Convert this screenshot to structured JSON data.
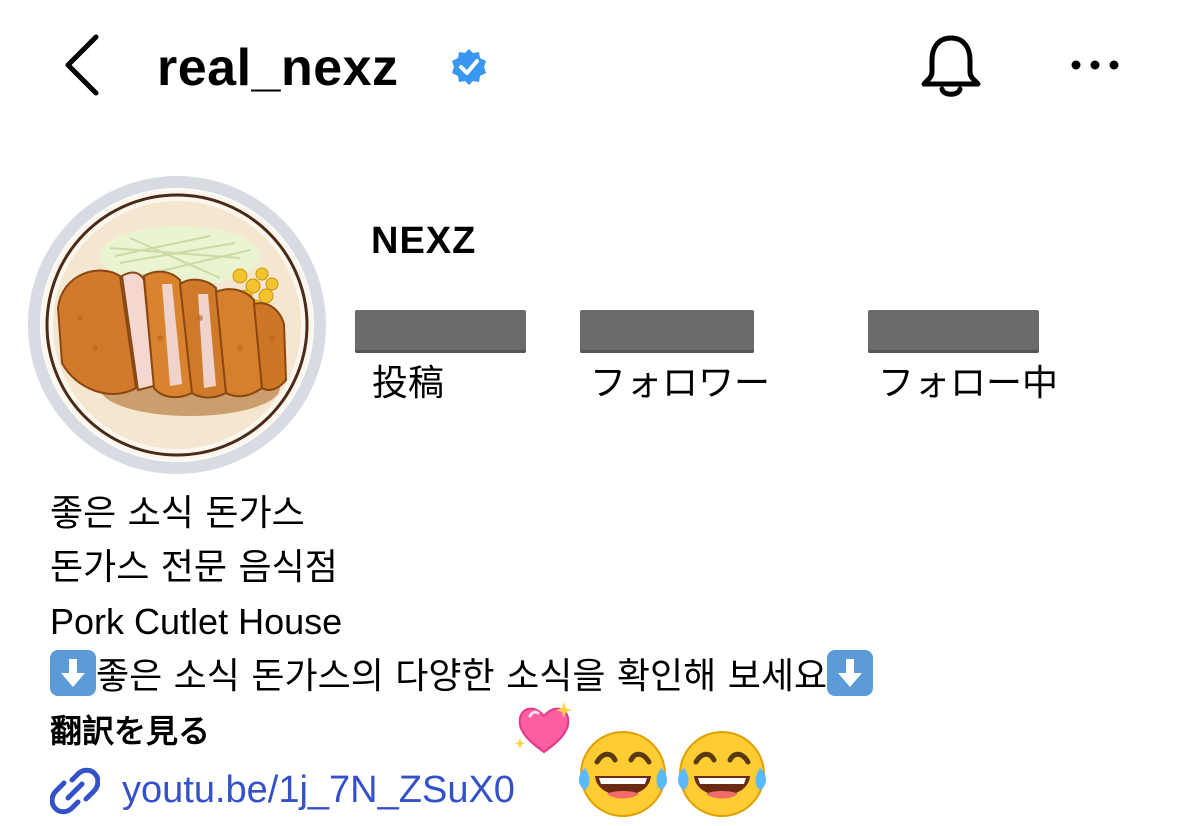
{
  "header": {
    "username": "real_nexz",
    "icons": [
      "back-chevron-icon",
      "verified-badge-icon",
      "bell-icon",
      "more-icon"
    ]
  },
  "profile": {
    "display_name": "NEXZ",
    "avatar_icon": "pork-cutlet-plate-image",
    "stats": [
      {
        "label": "投稿"
      },
      {
        "label": "フォロワー"
      },
      {
        "label": "フォロー中"
      }
    ]
  },
  "bio": {
    "line1": "좋은 소식 돈가스",
    "line2": "돈가스 전문 음식점",
    "line3": "Pork Cutlet House",
    "line4": "좋은 소식 돈가스의 다양한 소식을 확인해 보세요",
    "line4_icons": [
      "down-arrow-icon",
      "down-arrow-icon"
    ],
    "see_translation": "翻訳を見る",
    "link": "youtu.be/1j_7N_ZSuX0"
  },
  "stickers": [
    "sparkling-heart-emoji",
    "tears-of-joy-emoji",
    "tears-of-joy-emoji"
  ],
  "colors": {
    "verified": "#3897f0",
    "link": "#3551c9",
    "redaction": "#6b6b6d",
    "avatar_ring": "#d9dbe3"
  }
}
